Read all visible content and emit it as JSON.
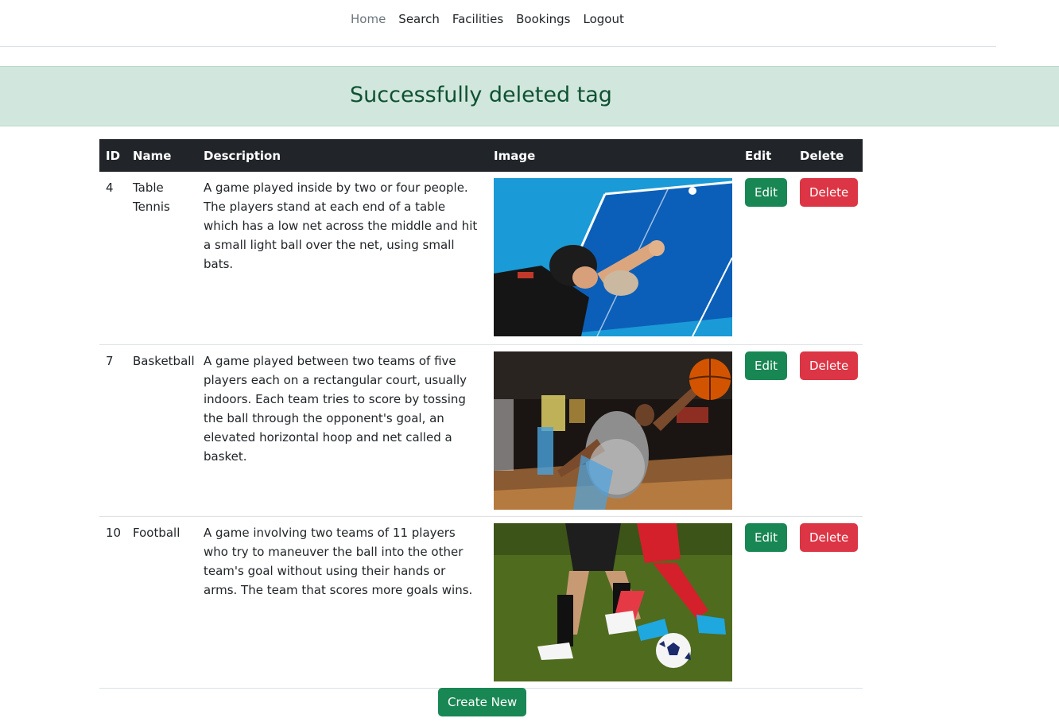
{
  "nav": {
    "items": [
      {
        "label": "Home",
        "active": true
      },
      {
        "label": "Search"
      },
      {
        "label": "Facilities"
      },
      {
        "label": "Bookings"
      },
      {
        "label": "Logout"
      }
    ]
  },
  "alert": {
    "message": "Successfully deleted tag"
  },
  "table": {
    "headers": {
      "id": "ID",
      "name": "Name",
      "description": "Description",
      "image": "Image",
      "edit": "Edit",
      "delete": "Delete"
    },
    "rows": [
      {
        "id": "4",
        "name": "Table Tennis",
        "description": "A game played inside by two or four people. The players stand at each end of a table which has a low net across the middle and hit a small light ball over the net, using small bats.",
        "edit_label": "Edit",
        "delete_label": "Delete"
      },
      {
        "id": "7",
        "name": "Basketball",
        "description": "A game played between two teams of five players each on a rectangular court, usually indoors. Each team tries to score by tossing the ball through the opponent's goal, an elevated horizontal hoop and net called a basket.",
        "edit_label": "Edit",
        "delete_label": "Delete"
      },
      {
        "id": "10",
        "name": "Football",
        "description": "A game involving two teams of 11 players who try to maneuver the ball into the other team's goal without using their hands or arms. The team that scores more goals wins.",
        "edit_label": "Edit",
        "delete_label": "Delete"
      }
    ]
  },
  "create_button": "Create New",
  "colors": {
    "success": "#198754",
    "danger": "#dc3545",
    "alert_bg": "#d1e7dd",
    "alert_text": "#0f5132",
    "table_header": "#212529"
  }
}
